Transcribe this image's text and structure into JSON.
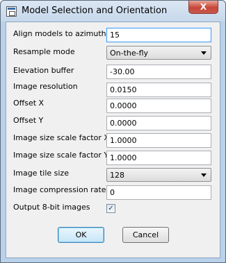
{
  "window": {
    "title": "Model Selection and Orientation",
    "close_symbol": "X"
  },
  "rows": [
    {
      "label": "Align models to azimuth",
      "type": "text",
      "value": "15"
    },
    {
      "label": "Resample mode",
      "type": "combo",
      "value": "On-the-fly"
    },
    {
      "label": "Elevation buffer",
      "type": "text",
      "value": "-30.00"
    },
    {
      "label": "Image resolution",
      "type": "text",
      "value": "0.0150"
    },
    {
      "label": "Offset X",
      "type": "text",
      "value": "0.0000"
    },
    {
      "label": "Offset Y",
      "type": "text",
      "value": "0.0000"
    },
    {
      "label": "Image size scale factor X",
      "type": "text",
      "value": "1.0000"
    },
    {
      "label": "Image size scale factor Y",
      "type": "text",
      "value": "1.0000"
    },
    {
      "label": "Image tile size",
      "type": "combo",
      "value": "128"
    },
    {
      "label": "Image compression rate",
      "type": "text",
      "value": "0"
    },
    {
      "label": "Output 8-bit images",
      "type": "checkbox",
      "checked": true,
      "check_mark": "✓"
    }
  ],
  "buttons": {
    "ok": "OK",
    "cancel": "Cancel"
  },
  "icons": {
    "app": "window-app-icon",
    "close": "close-icon",
    "dropdown": "chevron-down-icon"
  }
}
